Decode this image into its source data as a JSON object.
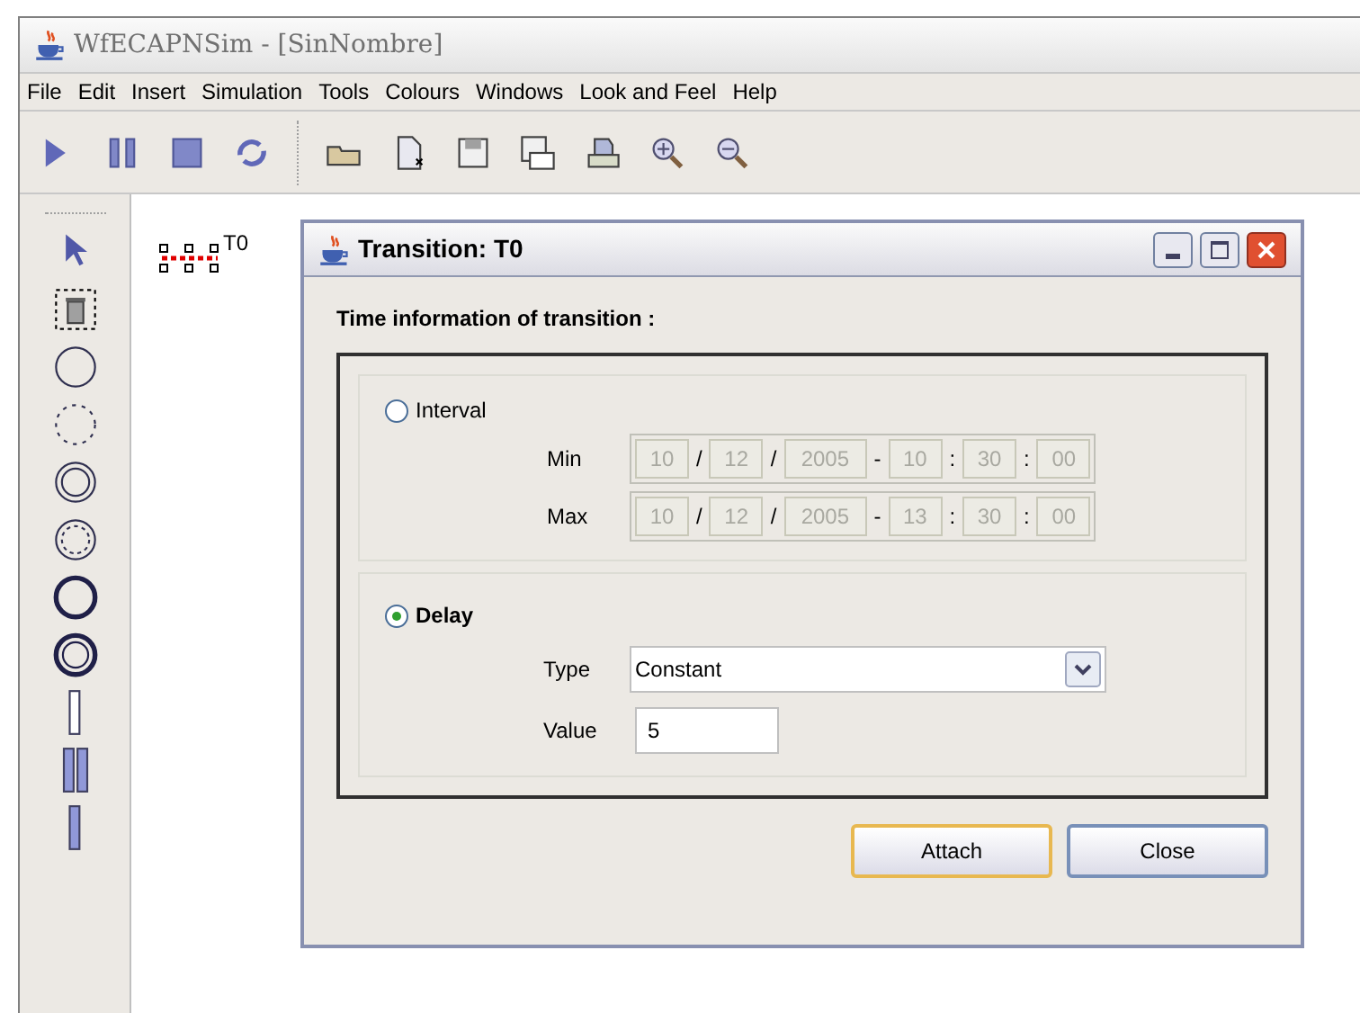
{
  "window": {
    "title": "WfECAPNSim - [SinNombre]"
  },
  "menu": [
    "File",
    "Edit",
    "Insert",
    "Simulation",
    "Tools",
    "Colours",
    "Windows",
    "Look and Feel",
    "Help"
  ],
  "canvas": {
    "label": "T0"
  },
  "dialog": {
    "title": "Transition: T0",
    "heading": "Time information of transition :",
    "interval": {
      "label": "Interval",
      "selected": false,
      "rows": [
        {
          "label": "Min",
          "parts": [
            {
              "kind": "field",
              "text": "10",
              "disabled": true
            },
            {
              "kind": "sep",
              "text": "/"
            },
            {
              "kind": "field",
              "text": "12",
              "disabled": true
            },
            {
              "kind": "sep",
              "text": "/"
            },
            {
              "kind": "field",
              "text": "2005",
              "disabled": true
            },
            {
              "kind": "sep",
              "text": "-"
            },
            {
              "kind": "field",
              "text": "10",
              "disabled": true
            },
            {
              "kind": "sep",
              "text": ":"
            },
            {
              "kind": "field",
              "text": "30",
              "disabled": true
            },
            {
              "kind": "sep",
              "text": ":"
            },
            {
              "kind": "field",
              "text": "00",
              "disabled": true
            }
          ]
        },
        {
          "label": "Max",
          "parts": [
            {
              "kind": "field",
              "text": "10",
              "disabled": true
            },
            {
              "kind": "sep",
              "text": "/"
            },
            {
              "kind": "field",
              "text": "12",
              "disabled": true
            },
            {
              "kind": "sep",
              "text": "/"
            },
            {
              "kind": "field",
              "text": "2005",
              "disabled": true
            },
            {
              "kind": "sep",
              "text": "-"
            },
            {
              "kind": "field",
              "text": "13",
              "disabled": true
            },
            {
              "kind": "sep",
              "text": ":"
            },
            {
              "kind": "field",
              "text": "30",
              "disabled": true
            },
            {
              "kind": "sep",
              "text": ":"
            },
            {
              "kind": "field",
              "text": "00",
              "disabled": true
            }
          ]
        }
      ]
    },
    "delay": {
      "label": "Delay",
      "selected": true,
      "type_label": "Type",
      "type_value": "Constant",
      "value_label": "Value",
      "value": "5"
    },
    "buttons": [
      {
        "label": "Attach",
        "default": true
      },
      {
        "label": "Close",
        "default": false
      }
    ]
  }
}
